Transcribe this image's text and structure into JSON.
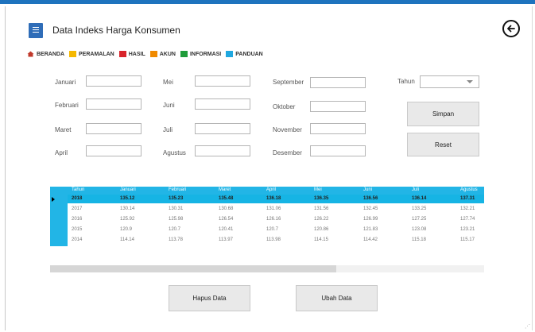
{
  "window": {
    "title": "Data Indeks Harga Konsumen"
  },
  "nav": [
    {
      "label": "BERANDA",
      "icon": "home-icon",
      "color": "#c0392b"
    },
    {
      "label": "PERAMALAN",
      "icon": "forecast-icon",
      "color": "#f5b800"
    },
    {
      "label": "HASIL",
      "icon": "result-icon",
      "color": "#d8232a"
    },
    {
      "label": "AKUN",
      "icon": "account-icon",
      "color": "#f08a00"
    },
    {
      "label": "INFORMASI",
      "icon": "info-icon",
      "color": "#1f9c3a"
    },
    {
      "label": "PANDUAN",
      "icon": "guide-icon",
      "color": "#20a8e0"
    }
  ],
  "form": {
    "months": [
      "Januari",
      "Februari",
      "Maret",
      "April",
      "Mei",
      "Juni",
      "Juli",
      "Agustus",
      "September",
      "Oktober",
      "November",
      "Desember"
    ],
    "year_label": "Tahun",
    "year_value": "",
    "save_label": "Simpan",
    "reset_label": "Reset"
  },
  "table": {
    "headers": [
      "Tahun",
      "Januari",
      "Februari",
      "Maret",
      "April",
      "Mei",
      "Juni",
      "Juli",
      "Agustus"
    ],
    "rows": [
      [
        "2018",
        "135.12",
        "135.23",
        "135.48",
        "136.18",
        "136.35",
        "136.56",
        "136.14",
        "137.31"
      ],
      [
        "2017",
        "130.14",
        "130.31",
        "130.68",
        "131.06",
        "131.56",
        "132.45",
        "133.25",
        "132.21"
      ],
      [
        "2016",
        "125.92",
        "125.98",
        "126.54",
        "126.16",
        "126.22",
        "126.99",
        "127.25",
        "127.74"
      ],
      [
        "2015",
        "120.9",
        "120.7",
        "120.41",
        "120.7",
        "120.86",
        "121.83",
        "123.08",
        "123.21"
      ],
      [
        "2014",
        "114.14",
        "113.78",
        "113.97",
        "113.98",
        "114.15",
        "114.42",
        "115.18",
        "115.17"
      ]
    ],
    "selected_row": 0,
    "header_color": "#22b5e6",
    "scroll_thumb_fraction": 0.66
  },
  "actions": {
    "delete_label": "Hapus Data",
    "edit_label": "Ubah Data"
  }
}
